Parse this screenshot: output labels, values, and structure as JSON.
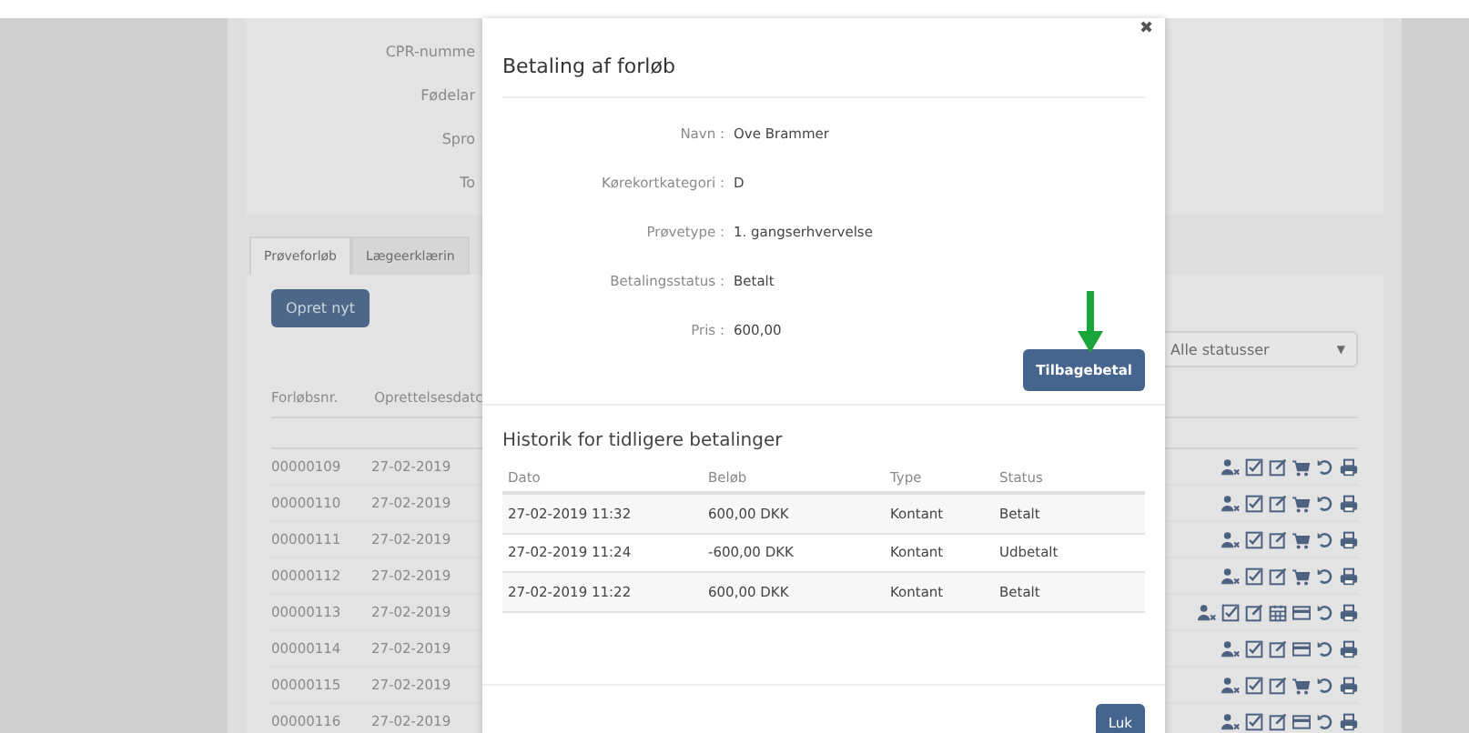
{
  "background": {
    "info_labels": [
      "CPR-numme",
      "Fødelar",
      "Spro",
      "To"
    ],
    "tabs": [
      {
        "label": "Prøveforløb",
        "selected": true
      },
      {
        "label": "Lægeerklærin",
        "selected": false
      }
    ],
    "create_button": "Opret nyt",
    "status_filter": "Alle statusser",
    "status_caret": "▼",
    "columns": [
      "Forløbsnr.",
      "Oprettelsesdatc"
    ],
    "rows": [
      {
        "number": "00000109",
        "date": "27-02-2019",
        "actions": [
          {
            "kind": "user"
          },
          {
            "kind": "check"
          },
          {
            "kind": "edit"
          },
          {
            "kind": "cart"
          },
          {
            "kind": "undo"
          },
          {
            "kind": "print"
          }
        ]
      },
      {
        "number": "00000110",
        "date": "27-02-2019",
        "actions": [
          {
            "kind": "user"
          },
          {
            "kind": "check"
          },
          {
            "kind": "edit"
          },
          {
            "kind": "cart"
          },
          {
            "kind": "undo"
          },
          {
            "kind": "print"
          }
        ]
      },
      {
        "number": "00000111",
        "date": "27-02-2019",
        "actions": [
          {
            "kind": "user"
          },
          {
            "kind": "check"
          },
          {
            "kind": "edit"
          },
          {
            "kind": "cart"
          },
          {
            "kind": "undo"
          },
          {
            "kind": "print"
          }
        ]
      },
      {
        "number": "00000112",
        "date": "27-02-2019",
        "actions": [
          {
            "kind": "user"
          },
          {
            "kind": "check"
          },
          {
            "kind": "edit"
          },
          {
            "kind": "cart"
          },
          {
            "kind": "undo"
          },
          {
            "kind": "print"
          }
        ]
      },
      {
        "number": "00000113",
        "date": "27-02-2019",
        "actions": [
          {
            "kind": "user"
          },
          {
            "kind": "check"
          },
          {
            "kind": "edit"
          },
          {
            "kind": "calendar"
          },
          {
            "kind": "card"
          },
          {
            "kind": "undo"
          },
          {
            "kind": "print"
          }
        ]
      },
      {
        "number": "00000114",
        "date": "27-02-2019",
        "actions": [
          {
            "kind": "user"
          },
          {
            "kind": "check"
          },
          {
            "kind": "edit"
          },
          {
            "kind": "card"
          },
          {
            "kind": "undo"
          },
          {
            "kind": "print"
          }
        ]
      },
      {
        "number": "00000115",
        "date": "27-02-2019",
        "actions": [
          {
            "kind": "user"
          },
          {
            "kind": "check"
          },
          {
            "kind": "edit"
          },
          {
            "kind": "cart"
          },
          {
            "kind": "undo"
          },
          {
            "kind": "print"
          }
        ]
      },
      {
        "number": "00000116",
        "date": "27-02-2019",
        "actions": [
          {
            "kind": "user"
          },
          {
            "kind": "check"
          },
          {
            "kind": "edit"
          },
          {
            "kind": "card"
          },
          {
            "kind": "undo"
          },
          {
            "kind": "print"
          }
        ]
      }
    ]
  },
  "dialog": {
    "title": "Betaling af forløb",
    "close": "✖",
    "fields": [
      {
        "label": "Navn :",
        "value": "Ove Brammer"
      },
      {
        "label": "Kørekortkategori :",
        "value": "D"
      },
      {
        "label": "Prøvetype :",
        "value": "1. gangserhvervelse"
      },
      {
        "label": "Betalingsstatus :",
        "value": "Betalt"
      },
      {
        "label": "Pris :",
        "value": "600,00"
      }
    ],
    "refund_button": "Tilbagebetal",
    "history": {
      "title": "Historik for tidligere betalinger",
      "columns": [
        "Dato",
        "Beløb",
        "Type",
        "Status"
      ],
      "rows": [
        [
          "27-02-2019 11:32",
          "600,00 DKK",
          "Kontant",
          "Betalt"
        ],
        [
          "27-02-2019 11:24",
          "-600,00 DKK",
          "Kontant",
          "Udbetalt"
        ],
        [
          "27-02-2019 11:22",
          "600,00 DKK",
          "Kontant",
          "Betalt"
        ]
      ]
    },
    "close_button": "Luk"
  }
}
